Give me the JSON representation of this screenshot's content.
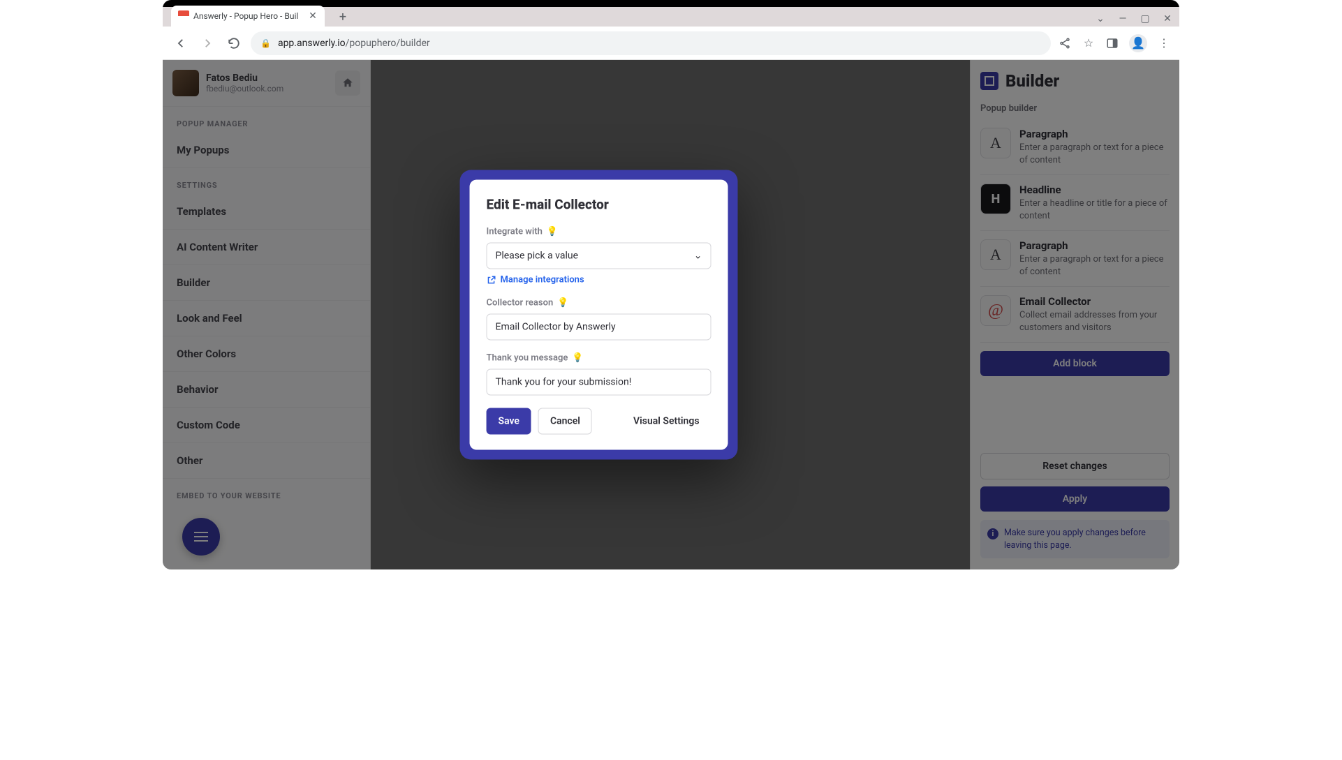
{
  "browser": {
    "tab_title": "Answerly - Popup Hero - Buil",
    "url_host": "app.answerly.io",
    "url_path": "/popuphero/builder"
  },
  "user": {
    "name": "Fatos Bediu",
    "email": "fbediu@outlook.com"
  },
  "sidebar": {
    "sections": [
      {
        "label": "POPUP MANAGER",
        "items": [
          "My Popups"
        ]
      },
      {
        "label": "SETTINGS",
        "items": [
          "Templates",
          "AI Content Writer",
          "Builder",
          "Look and Feel",
          "Other Colors",
          "Behavior",
          "Custom Code",
          "Other"
        ]
      },
      {
        "label": "EMBED TO YOUR WEBSITE",
        "items": []
      }
    ]
  },
  "modal": {
    "title": "Edit E-mail Collector",
    "integrate_label": "Integrate with",
    "integrate_placeholder": "Please pick a value",
    "manage_link": "Manage integrations",
    "reason_label": "Collector reason",
    "reason_value": "Email Collector by Answerly",
    "thankyou_label": "Thank you message",
    "thankyou_value": "Thank you for your submission!",
    "save": "Save",
    "cancel": "Cancel",
    "visual": "Visual Settings"
  },
  "right_panel": {
    "title": "Builder",
    "subtitle": "Popup builder",
    "blocks": [
      {
        "icon": "A",
        "icon_style": "serif",
        "title": "Paragraph",
        "desc": "Enter a paragraph or text for a piece of content"
      },
      {
        "icon": "H",
        "icon_style": "dark",
        "title": "Headline",
        "desc": "Enter a headline or title for a piece of content"
      },
      {
        "icon": "A",
        "icon_style": "serif",
        "title": "Paragraph",
        "desc": "Enter a paragraph or text for a piece of content"
      },
      {
        "icon": "@",
        "icon_style": "at",
        "title": "Email Collector",
        "desc": "Collect email addresses from your customers and visitors"
      }
    ],
    "add_block": "Add block",
    "reset": "Reset changes",
    "apply": "Apply",
    "notice": "Make sure you apply changes before leaving this page."
  }
}
